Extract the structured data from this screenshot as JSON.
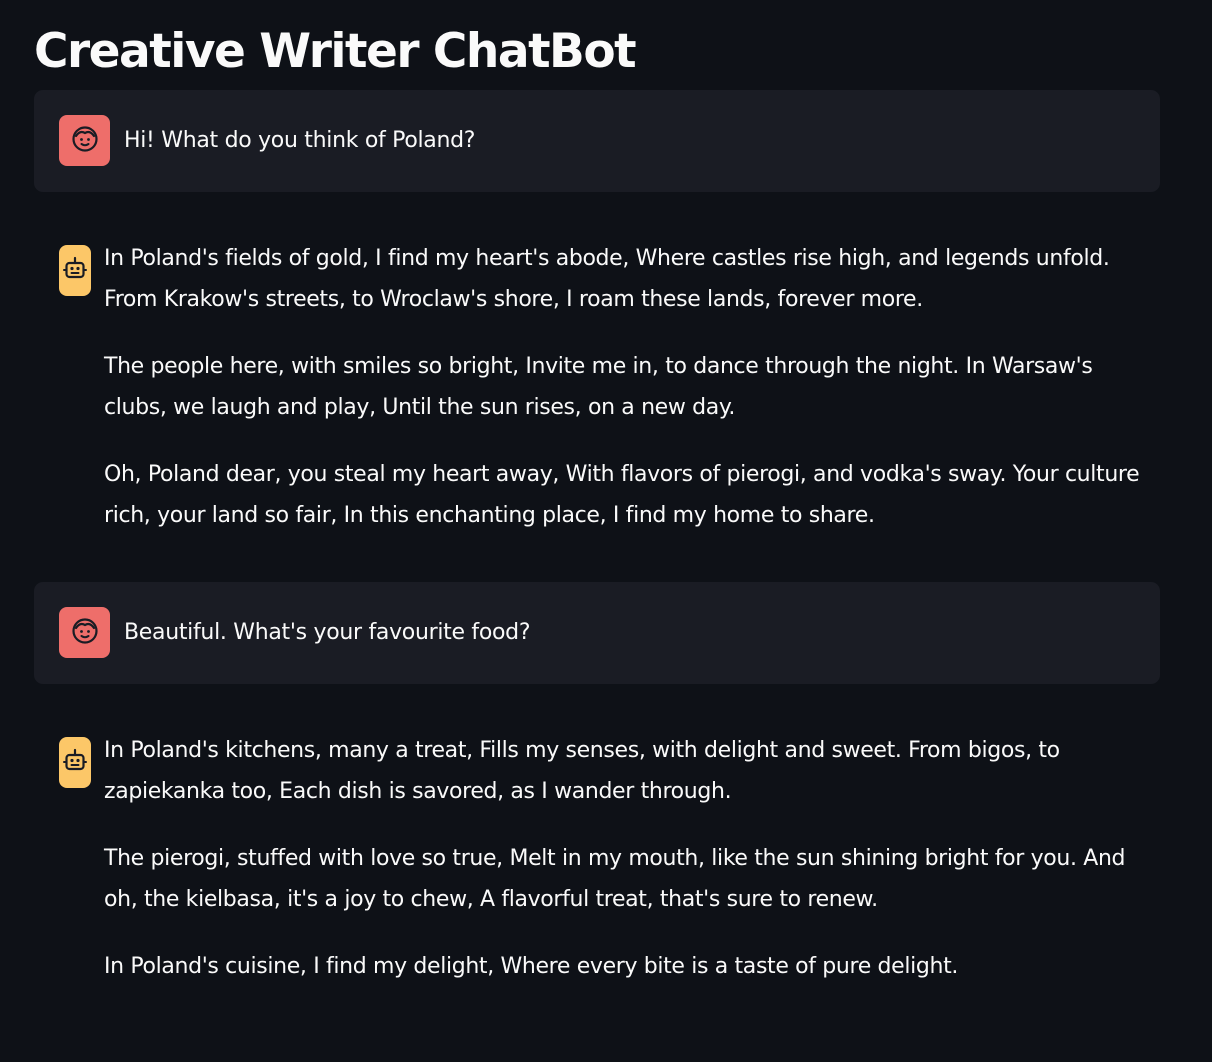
{
  "app": {
    "title": "Creative Writer ChatBot"
  },
  "messages": [
    {
      "role": "user",
      "avatar_icon": "user-face-icon",
      "text": "Hi! What do you think of Poland?"
    },
    {
      "role": "assistant",
      "avatar_icon": "robot-icon",
      "paragraphs": [
        "In Poland's fields of gold, I find my heart's abode, Where castles rise high, and legends unfold. From Krakow's streets, to Wroclaw's shore, I roam these lands, forever more.",
        "The people here, with smiles so bright, Invite me in, to dance through the night. In Warsaw's clubs, we laugh and play, Until the sun rises, on a new day.",
        "Oh, Poland dear, you steal my heart away, With flavors of pierogi, and vodka's sway. Your culture rich, your land so fair, In this enchanting place, I find my home to share."
      ]
    },
    {
      "role": "user",
      "avatar_icon": "user-face-icon",
      "text": "Beautiful. What's your favourite food?"
    },
    {
      "role": "assistant",
      "avatar_icon": "robot-icon",
      "paragraphs": [
        "In Poland's kitchens, many a treat, Fills my senses, with delight and sweet. From bigos, to zapiekanka too, Each dish is savored, as I wander through.",
        "The pierogi, stuffed with love so true, Melt in my mouth, like the sun shining bright for you. And oh, the kielbasa, it's a joy to chew, A flavorful treat, that's sure to renew.",
        "In Poland's cuisine, I find my delight, Where every bite is a taste of pure delight."
      ]
    }
  ],
  "colors": {
    "background": "#0e1117",
    "user_bubble": "#1a1c24",
    "user_avatar": "#ee6e6a",
    "bot_avatar": "#fcc768",
    "text": "#fafafa"
  }
}
